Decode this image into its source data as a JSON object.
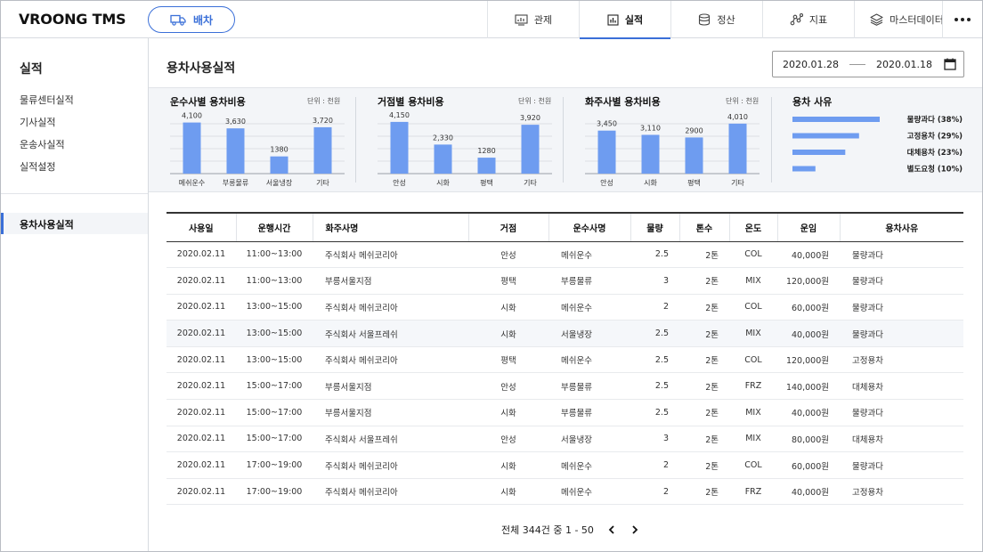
{
  "app": {
    "logo": "VROONG TMS",
    "dispatch_label": "배차"
  },
  "nav": {
    "tabs": [
      {
        "label": "관제",
        "icon": "monitor-chart-icon"
      },
      {
        "label": "실적",
        "icon": "bar-chart-icon",
        "active": true
      },
      {
        "label": "정산",
        "icon": "database-icon"
      },
      {
        "label": "지표",
        "icon": "graph-nodes-icon"
      },
      {
        "label": "마스터데이터",
        "icon": "layers-icon"
      }
    ],
    "more_icon": "more-dots-icon"
  },
  "sidebar": {
    "title": "실적",
    "items": [
      "물류센터실적",
      "기사실적",
      "운송사실적",
      "실적설정"
    ],
    "active_item": "용차사용실적"
  },
  "main": {
    "title": "용차사용실적",
    "date_from": "2020.01.28",
    "date_to": "2020.01.18"
  },
  "accent_color": "#3a6fd8",
  "bar_color": "#6e9cf0",
  "chart_data": [
    {
      "type": "bar",
      "title": "운수사별 용차비용",
      "unit": "단위 : 천원",
      "categories": [
        "메쉬운수",
        "부릉물류",
        "서울냉장",
        "기타"
      ],
      "values": [
        4100,
        3630,
        1380,
        3720
      ],
      "labels": [
        "4,100",
        "3,630",
        "1380",
        "3,720"
      ],
      "ylim": [
        0,
        5000
      ]
    },
    {
      "type": "bar",
      "title": "거점별 용차비용",
      "unit": "단위 : 천원",
      "categories": [
        "안성",
        "시화",
        "평택",
        "기타"
      ],
      "values": [
        4150,
        2330,
        1280,
        3920
      ],
      "labels": [
        "4,150",
        "2,330",
        "1280",
        "3,920"
      ],
      "ylim": [
        0,
        5000
      ]
    },
    {
      "type": "bar",
      "title": "화주사별 용차비용",
      "unit": "단위 : 천원",
      "categories": [
        "안성",
        "시화",
        "평택",
        "기타"
      ],
      "values": [
        3450,
        3110,
        2900,
        4010
      ],
      "labels": [
        "3,450",
        "3,110",
        "2900",
        "4,010"
      ],
      "ylim": [
        0,
        5000
      ]
    },
    {
      "type": "bar",
      "orientation": "horizontal",
      "title": "용차 사유",
      "categories": [
        "물량과다 (38%)",
        "고정용차 (29%)",
        "대체용차 (23%)",
        "별도요청 (10%)"
      ],
      "values": [
        38,
        29,
        23,
        10
      ],
      "ylim": [
        0,
        38
      ]
    }
  ],
  "table": {
    "columns": [
      "사용일",
      "운행시간",
      "화주사명",
      "거점",
      "운수사명",
      "물량",
      "톤수",
      "온도",
      "운임",
      "용차사유"
    ],
    "rows": [
      [
        "2020.02.11",
        "11:00~13:00",
        "주식회사 메쉬코리아",
        "안성",
        "메쉬운수",
        "2.5",
        "2톤",
        "COL",
        "40,000원",
        "물량과다"
      ],
      [
        "2020.02.11",
        "11:00~13:00",
        "부릉서울지점",
        "평택",
        "부릉물류",
        "3",
        "2톤",
        "MIX",
        "120,000원",
        "물량과다"
      ],
      [
        "2020.02.11",
        "13:00~15:00",
        "주식회사 메쉬코리아",
        "시화",
        "메쉬운수",
        "2",
        "2톤",
        "COL",
        "60,000원",
        "물량과다"
      ],
      [
        "2020.02.11",
        "13:00~15:00",
        "주식회사 서울프레쉬",
        "시화",
        "서울냉장",
        "2.5",
        "2톤",
        "MIX",
        "40,000원",
        "물량과다"
      ],
      [
        "2020.02.11",
        "13:00~15:00",
        "주식회사 메쉬코리아",
        "평택",
        "메쉬운수",
        "2.5",
        "2톤",
        "COL",
        "120,000원",
        "고정용차"
      ],
      [
        "2020.02.11",
        "15:00~17:00",
        "부릉서울지점",
        "안성",
        "부릉물류",
        "2.5",
        "2톤",
        "FRZ",
        "140,000원",
        "대체용차"
      ],
      [
        "2020.02.11",
        "15:00~17:00",
        "부릉서울지점",
        "시화",
        "부릉물류",
        "2.5",
        "2톤",
        "MIX",
        "40,000원",
        "물량과다"
      ],
      [
        "2020.02.11",
        "15:00~17:00",
        "주식회사 서울프레쉬",
        "안성",
        "서울냉장",
        "3",
        "2톤",
        "MIX",
        "80,000원",
        "대체용차"
      ],
      [
        "2020.02.11",
        "17:00~19:00",
        "주식회사 메쉬코리아",
        "시화",
        "메쉬운수",
        "2",
        "2톤",
        "COL",
        "60,000원",
        "물량과다"
      ],
      [
        "2020.02.11",
        "17:00~19:00",
        "주식회사 메쉬코리아",
        "시화",
        "메쉬운수",
        "2",
        "2톤",
        "FRZ",
        "40,000원",
        "고정용차"
      ]
    ],
    "highlighted_row": 3
  },
  "pagination": {
    "summary": "전체 344건 중 1 - 50"
  }
}
